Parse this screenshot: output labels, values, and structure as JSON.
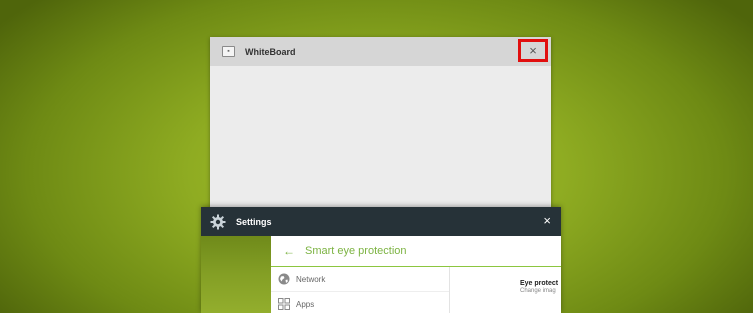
{
  "whiteboard_card": {
    "title": "WhiteBoard",
    "icon": "whiteboard-app-icon",
    "close_glyph": "×"
  },
  "settings_card": {
    "title": "Settings",
    "icon": "gear-icon",
    "close_glyph": "×",
    "toolbar": {
      "back_glyph": "←",
      "title": "Smart eye protection"
    },
    "nav_items": [
      {
        "label": "Network",
        "icon": "globe-icon"
      },
      {
        "label": "Apps",
        "icon": "apps-grid-icon"
      }
    ],
    "detail": {
      "title": "Eye protect",
      "subtitle": "Change imag"
    }
  },
  "colors": {
    "highlight": "#e10e0e",
    "accent_green": "#7cb342",
    "settings_header": "#263238",
    "wallpaper": "#8fac22"
  }
}
